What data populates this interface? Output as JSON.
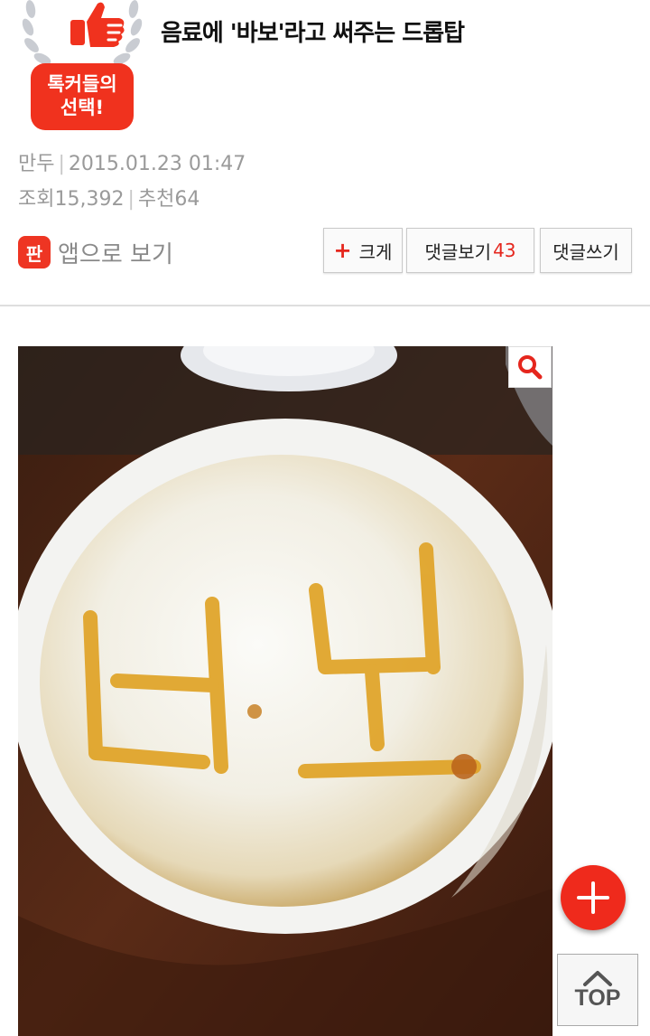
{
  "badge": {
    "line1": "톡커들의",
    "line2": "선택!"
  },
  "post": {
    "title": "음료에 '바보'라고 써주는 드롭탑",
    "author": "만두",
    "date": "2015.01.23 01:47",
    "views_label": "조회",
    "views": "15,392",
    "recommend_label": "추천",
    "recommend": "64"
  },
  "app_link": {
    "icon_text": "판",
    "label": "앱으로 보기"
  },
  "buttons": {
    "bigger_plus": "+",
    "bigger": "크게",
    "comments": "댓글보기",
    "comments_count": "43",
    "write_comment": "댓글쓰기"
  },
  "floating": {
    "top": "TOP"
  },
  "icons": [
    "laurel-icon",
    "thumbs-up-icon",
    "magnifier-icon",
    "plus-icon",
    "chevron-up-icon"
  ],
  "colors": {
    "accent": "#ef2a1c"
  }
}
